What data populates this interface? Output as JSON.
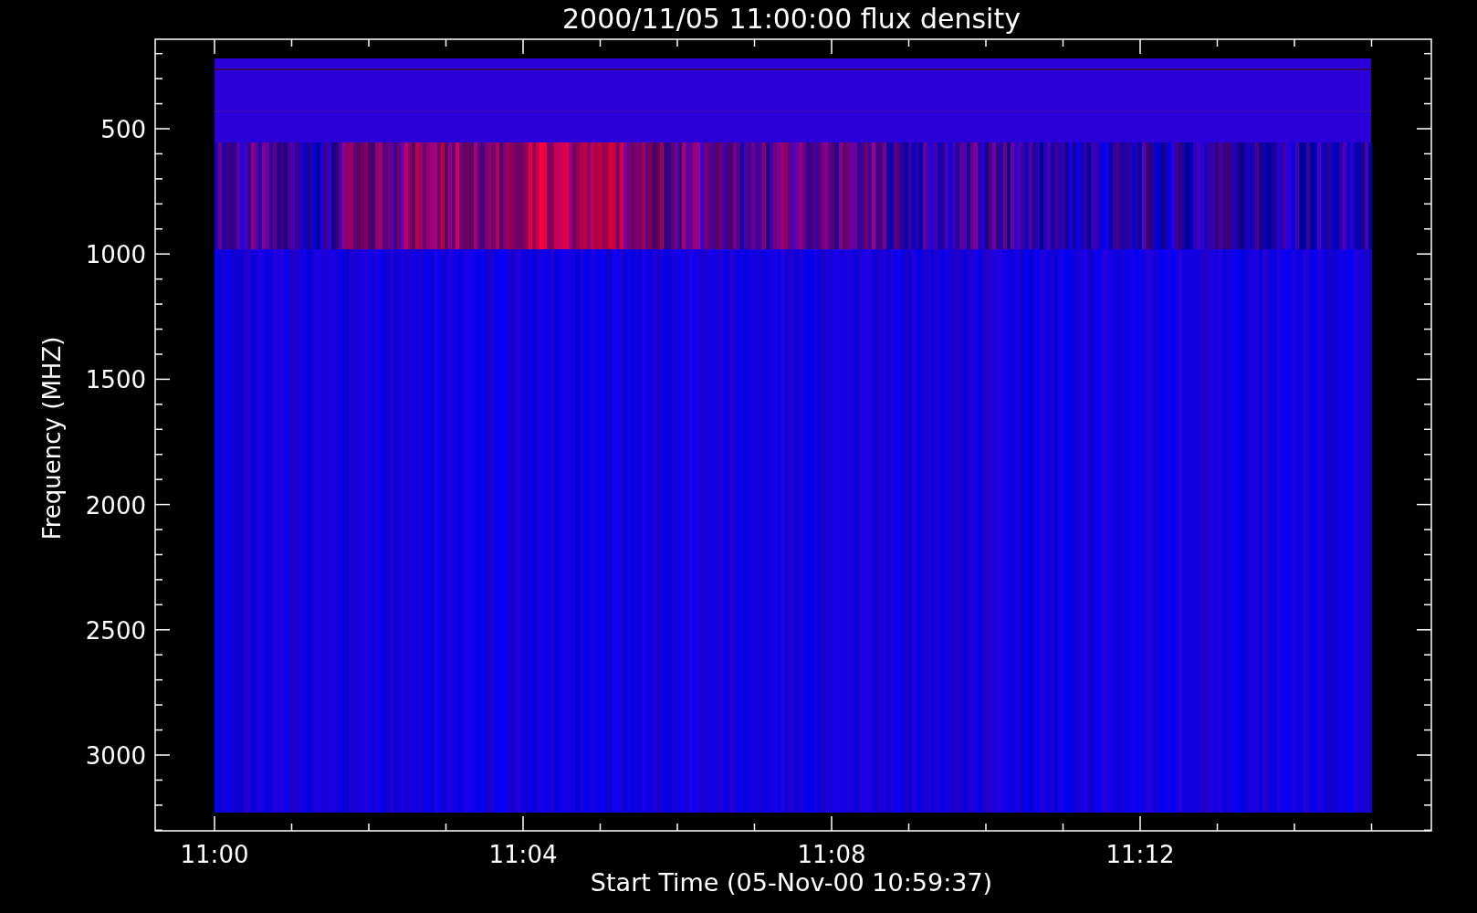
{
  "plot": {
    "title": "2000/11/05 11:00:00 flux density",
    "xlabel": "Start Time (05-Nov-00 10:59:37)",
    "ylabel": "Frequency (MHZ)",
    "yticks": [
      "500",
      "1000",
      "1500",
      "2000",
      "2500",
      "3000"
    ],
    "xticks": [
      "11:00",
      "11:04",
      "11:08",
      "11:12"
    ]
  }
}
